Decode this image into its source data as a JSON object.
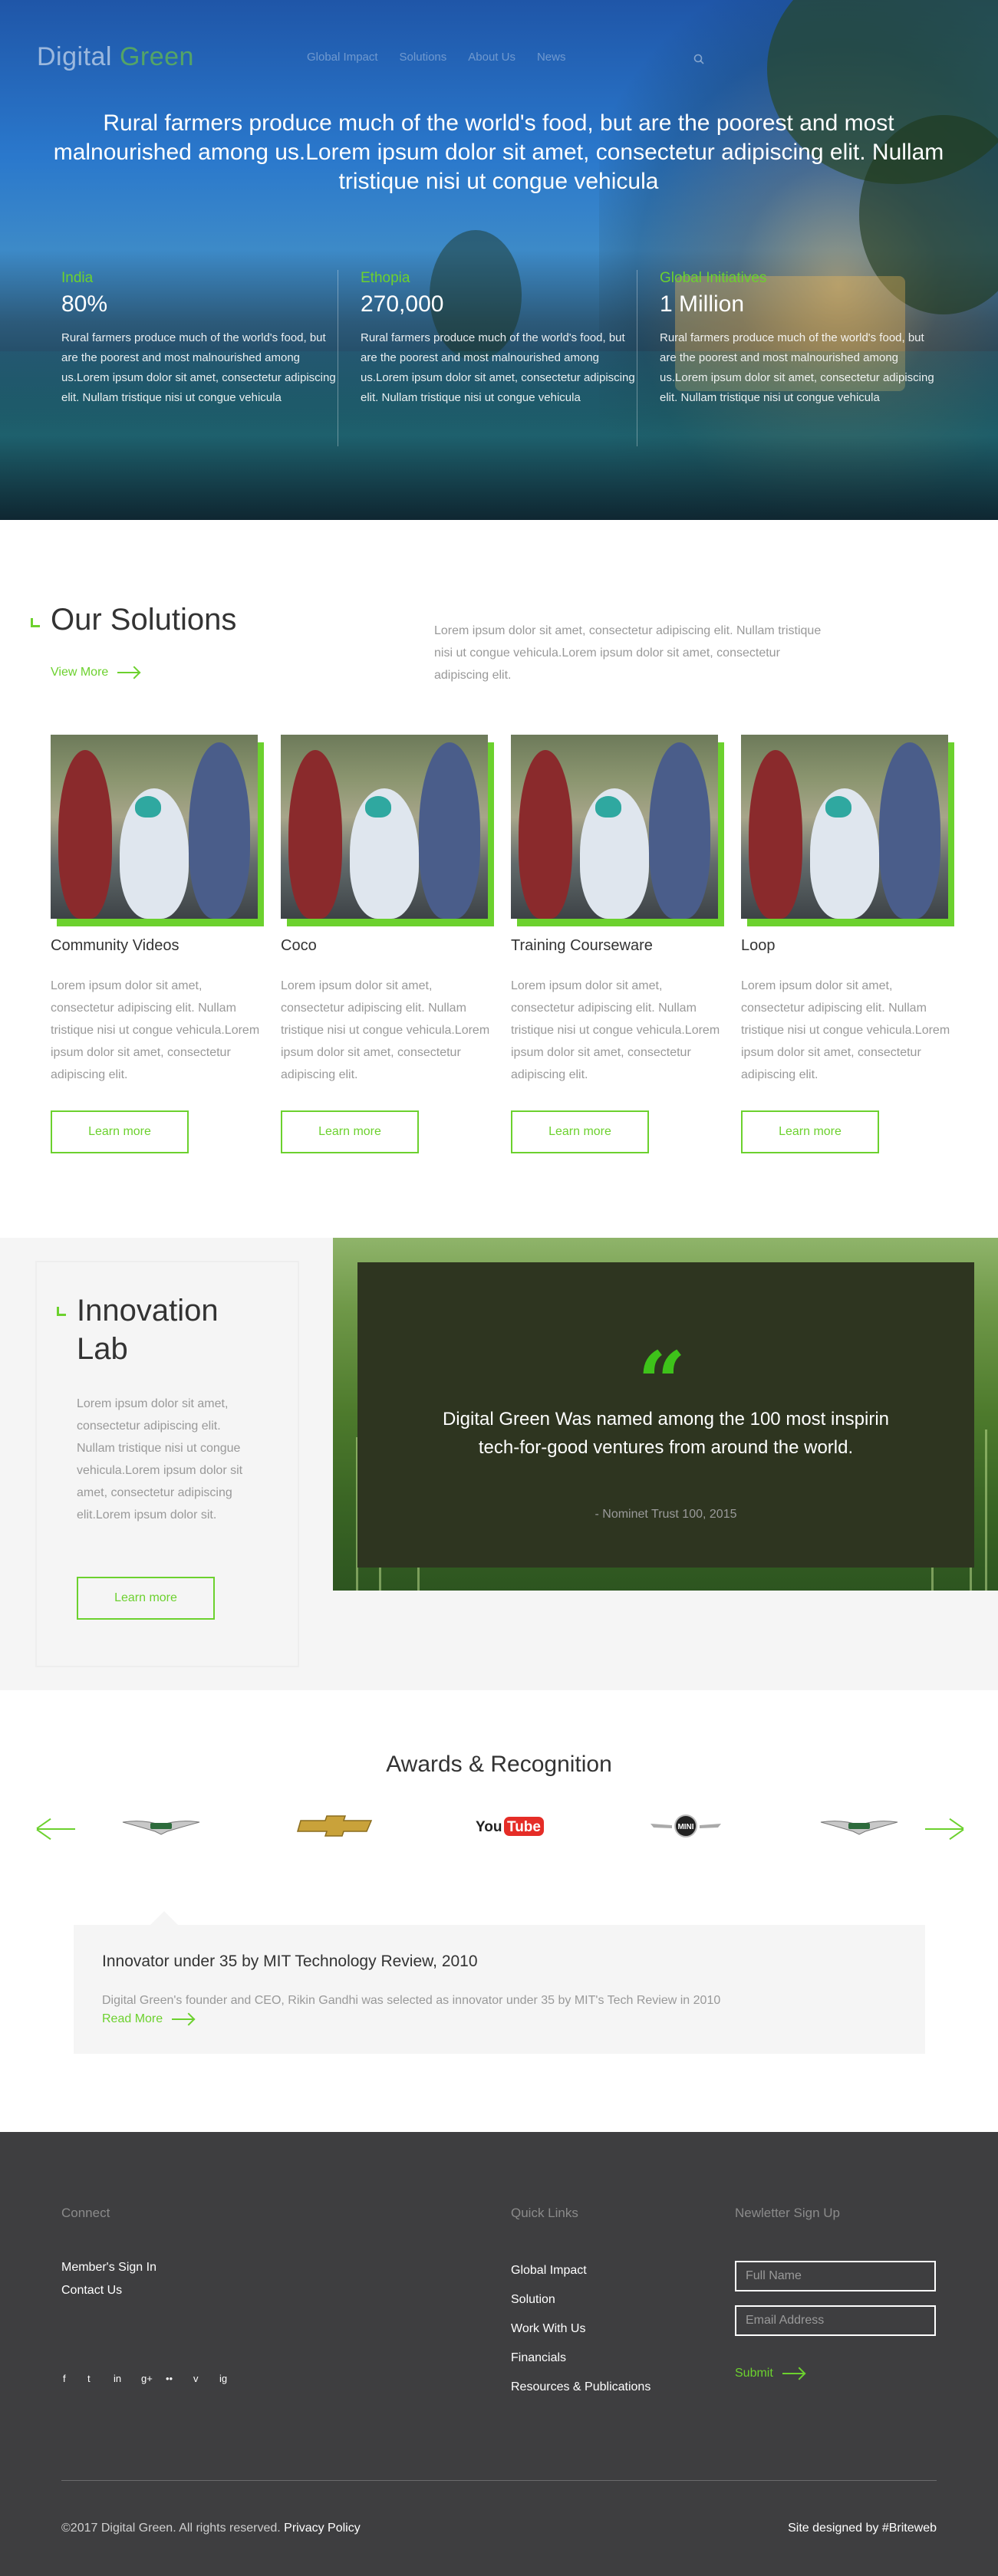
{
  "brand": {
    "part1": "Digital ",
    "part2": "Green"
  },
  "nav": [
    "Global Impact",
    "Solutions",
    "About Us",
    "News"
  ],
  "hero": {
    "headline": "Rural farmers produce much of the world's food, but are the poorest and most malnourished among us.Lorem ipsum dolor sit amet, consectetur adipiscing elit. Nullam tristique nisi ut congue vehicula",
    "stats": [
      {
        "title": "India",
        "value": "80%",
        "desc": "Rural farmers produce much of the world's food, but are the poorest and most malnourished among us.Lorem ipsum dolor sit amet, consectetur adipiscing elit. Nullam tristique nisi ut congue vehicula"
      },
      {
        "title": "Ethopia",
        "value": "270,000",
        "desc": "Rural farmers produce much of the world's food, but are the poorest and most malnourished among us.Lorem ipsum dolor sit amet, consectetur adipiscing elit. Nullam tristique nisi ut congue vehicula"
      },
      {
        "title": "Global Initiatives",
        "value": "1 Million",
        "desc": "Rural farmers produce much of the world's food, but are the poorest and most malnourished among us.Lorem ipsum dolor sit amet, consectetur adipiscing elit. Nullam tristique nisi ut congue vehicula"
      }
    ]
  },
  "solutions": {
    "title": "Our Solutions",
    "view_more": "View More",
    "intro": "Lorem ipsum dolor sit amet, consectetur adipiscing elit. Nullam tristique nisi ut congue vehicula.Lorem ipsum dolor sit amet, consectetur adipiscing elit.",
    "cards": [
      {
        "name": "Community Videos",
        "desc": "Lorem ipsum dolor sit amet, consectetur adipiscing elit. Nullam tristique nisi ut congue vehicula.Lorem ipsum dolor sit amet, consectetur adipiscing elit.",
        "button": "Learn more"
      },
      {
        "name": "Coco",
        "desc": "Lorem ipsum dolor sit amet, consectetur adipiscing elit. Nullam tristique nisi ut congue vehicula.Lorem ipsum dolor sit amet, consectetur adipiscing elit.",
        "button": "Learn more"
      },
      {
        "name": "Training Courseware",
        "desc": "Lorem ipsum dolor sit amet, consectetur adipiscing elit. Nullam tristique nisi ut congue vehicula.Lorem ipsum dolor sit amet, consectetur adipiscing elit.",
        "button": "Learn more"
      },
      {
        "name": "Loop",
        "desc": "Lorem ipsum dolor sit amet, consectetur adipiscing elit. Nullam tristique nisi ut congue vehicula.Lorem ipsum dolor sit amet, consectetur adipiscing elit.",
        "button": "Learn more"
      }
    ]
  },
  "lab": {
    "title_line1": "Innovation",
    "title_line2": "Lab",
    "desc": "Lorem ipsum dolor sit amet, consectetur adipiscing elit. Nullam tristique nisi ut congue vehicula.Lorem ipsum dolor sit amet, consectetur adipiscing elit.Lorem ipsum dolor sit.",
    "button": "Learn more",
    "quote": "Digital Green Was named among the 100 most inspirin tech-for-good ventures from around the world.",
    "quote_source": "- Nominet Trust 100, 2015"
  },
  "awards": {
    "title": "Awards & Recognition",
    "logos": [
      "aston-martin-logo",
      "chevrolet-logo",
      "youtube-logo",
      "mini-logo",
      "aston-martin-logo"
    ],
    "youtube_text1": "You",
    "youtube_text2": "Tube",
    "mini_text": "MINI",
    "item_title": "Innovator under 35 by MIT Technology Review, 2010",
    "item_desc": "Digital Green's founder and CEO, Rikin Gandhi was selected as innovator under 35 by MIT's Tech Review in 2010",
    "item_link": "Read More"
  },
  "footer": {
    "connect_title": "Connect",
    "connect_links": [
      "Member's Sign In",
      "Contact Us"
    ],
    "social": [
      "f",
      "t",
      "in",
      "g+",
      "••",
      "v",
      "ig"
    ],
    "quick_title": "Quick Links",
    "quick_links": [
      "Global Impact",
      "Solution",
      "Work With Us",
      "Financials",
      "Resources & Publications"
    ],
    "newsletter_title": "Newletter Sign Up",
    "name_placeholder": "Full Name",
    "email_placeholder": "Email Address",
    "submit": "Submit",
    "copyright": "©2017 Digital Green. All rights reserved. ",
    "privacy": "Privacy Policy",
    "designed": "Site designed by #Briteweb"
  },
  "colors": {
    "accent": "#6cd12e",
    "footer_bg": "#3e3e40",
    "panel_bg": "#f5f5f5"
  }
}
